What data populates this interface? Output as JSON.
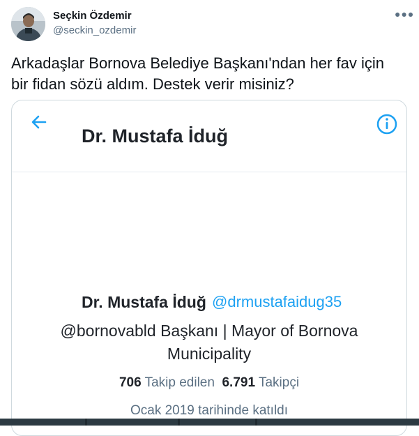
{
  "tweet": {
    "author_name": "Seçkin Özdemir",
    "author_handle": "@seckin_ozdemir",
    "more_icon": "more-horizontal-icon",
    "text_line1": "Arkadaşlar Bornova Belediye Başkanı'ndan her fav için",
    "text_line2": "bir fidan sözü aldım. Destek verir misiniz?"
  },
  "embedded": {
    "header_title": "Dr. Mustafa İduğ",
    "back_icon": "back-arrow-icon",
    "info_icon": "info-icon",
    "profile_name": "Dr. Mustafa İduğ",
    "profile_handle": "@drmustafaidug35",
    "bio_line1": "@bornovabld Başkanı | Mayor of Bornova",
    "bio_line2": "Municipality",
    "following_count": "706",
    "following_label": "Takip edilen",
    "followers_count": "6.791",
    "followers_label": "Takipçi",
    "joined": "Ocak 2019 tarihinde katıldı"
  },
  "colors": {
    "link": "#1da1f2",
    "muted": "#5b7083",
    "text": "#0f1419"
  }
}
